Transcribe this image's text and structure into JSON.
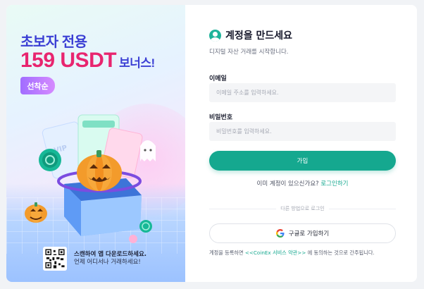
{
  "promo": {
    "title": "초보자 전용",
    "amount": "159 USDT",
    "amount_suffix": "보너스!",
    "badge": "선착순",
    "qr_title": "스캔하여 앱 다운로드하세요.",
    "qr_subtitle": "언제 어디서나 거래하세요!",
    "illustration_text": "VIP"
  },
  "form": {
    "title": "계정을 만드세요",
    "subtitle": "디지털 자산 거래를 시작합니다.",
    "email_label": "이메일",
    "email_placeholder": "이메일 주소를 입력하세요.",
    "password_label": "비밀번호",
    "password_placeholder": "비밀번호를 입력하세요.",
    "signup_button": "가입",
    "login_prompt": "이미 계정이 있으신가요?",
    "login_link": "로그인하기",
    "divider_text": "다른 방법으로 로그인",
    "google_button": "구글로 가입하기",
    "terms_prefix": "계정을 등록하면 ",
    "terms_link": "<<CoinEx 서비스 약관>>",
    "terms_suffix": " 에 동의하는 것으로 간주됩니다."
  },
  "colors": {
    "accent": "#15a88f",
    "promo_title": "#3b3fd4",
    "promo_amount": "#e8256f",
    "badge": "#b37bff"
  },
  "icons": [
    "user-avatar-icon",
    "google-icon",
    "qr-code",
    "pumpkin-illustration"
  ]
}
